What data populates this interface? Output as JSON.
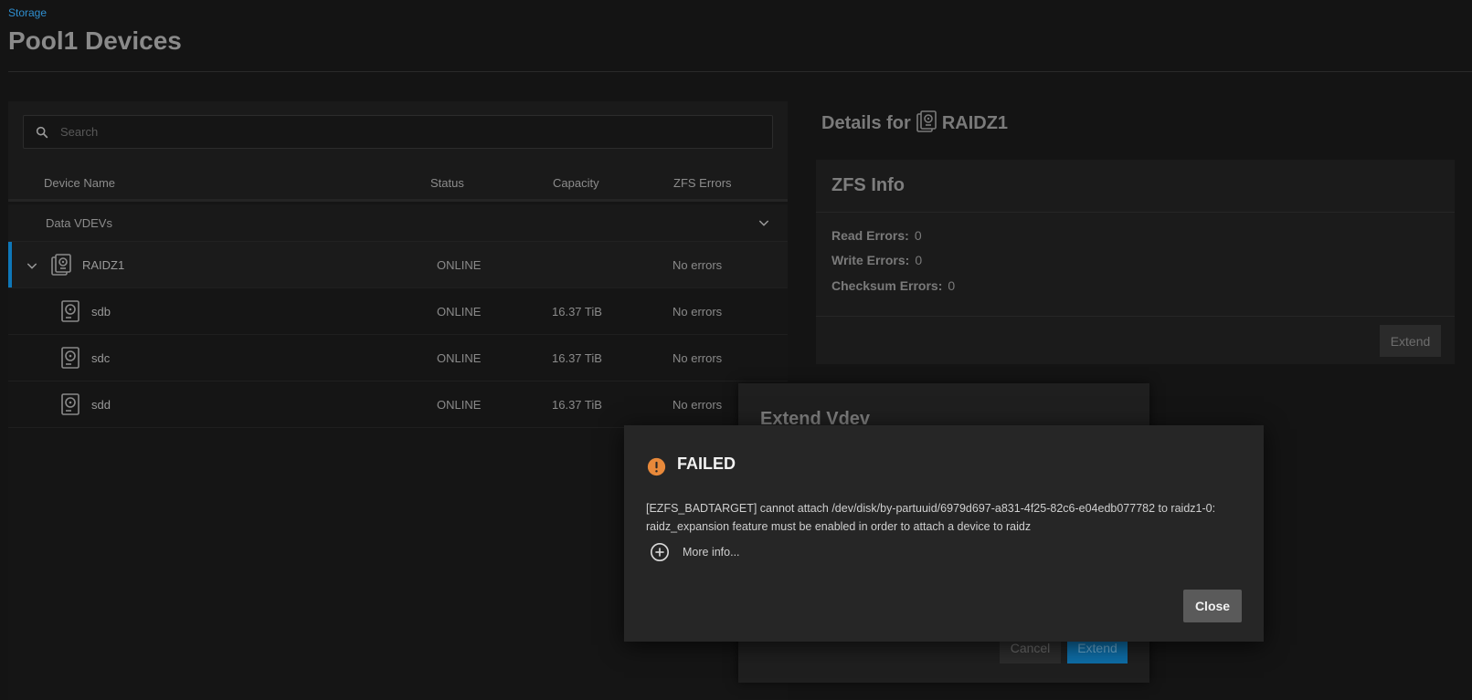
{
  "header": {
    "breadcrumb": "Storage",
    "title": "Pool1 Devices"
  },
  "search": {
    "placeholder": "Search",
    "value": ""
  },
  "table": {
    "columns": [
      "Device Name",
      "Status",
      "Capacity",
      "ZFS Errors"
    ],
    "group_label": "Data VDEVs",
    "vdev": {
      "name": "RAIDZ1",
      "status": "ONLINE",
      "capacity": "",
      "errors": "No errors"
    },
    "disks": [
      {
        "name": "sdb",
        "status": "ONLINE",
        "capacity": "16.37 TiB",
        "errors": "No errors"
      },
      {
        "name": "sdc",
        "status": "ONLINE",
        "capacity": "16.37 TiB",
        "errors": "No errors"
      },
      {
        "name": "sdd",
        "status": "ONLINE",
        "capacity": "16.37 TiB",
        "errors": "No errors"
      }
    ]
  },
  "details": {
    "prefix": "Details for",
    "name": "RAIDZ1",
    "card_title": "ZFS Info",
    "read_label": "Read Errors:",
    "read_value": "0",
    "write_label": "Write Errors:",
    "write_value": "0",
    "checksum_label": "Checksum Errors:",
    "checksum_value": "0",
    "extend_label": "Extend"
  },
  "extend_dialog": {
    "title": "Extend Vdev",
    "cancel_label": "Cancel",
    "extend_label": "Extend"
  },
  "error_dialog": {
    "title": "FAILED",
    "message": "[EZFS_BADTARGET] cannot attach /dev/disk/by-partuuid/6979d697-a831-4f25-82c6-e04edb077782 to raidz1-0: raidz_expansion feature must be enabled in order to attach a device to raidz",
    "more_info_label": "More info...",
    "close_label": "Close"
  },
  "colors": {
    "accent": "#0e77b8",
    "warning": "#e8893a",
    "background": "#141414"
  },
  "icons": {
    "search": "search-icon",
    "chevron": "chevron-down-icon",
    "vdev": "vdev-disks-icon",
    "disk": "hard-disk-icon",
    "warning": "warning-icon",
    "expand": "plus-circle-icon"
  }
}
